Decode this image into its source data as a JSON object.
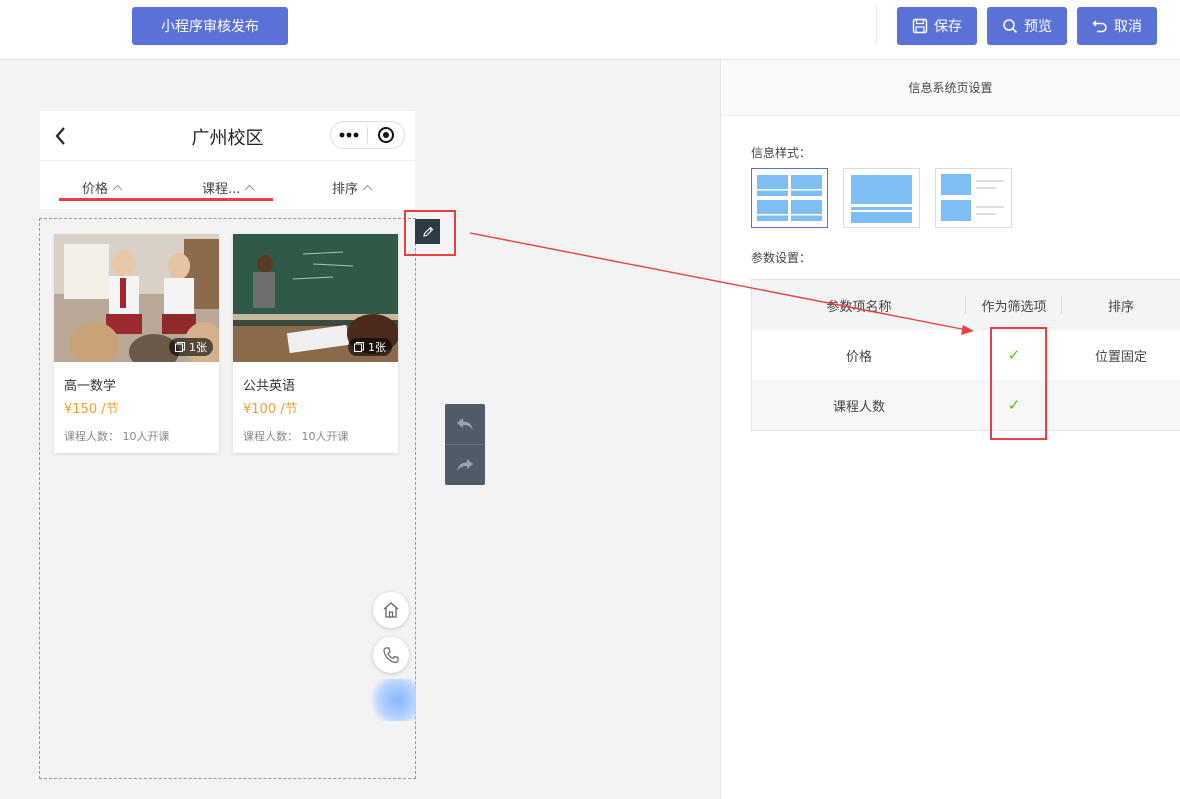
{
  "toolbar": {
    "publish_label": "小程序审核发布",
    "save_label": "保存",
    "preview_label": "预览",
    "cancel_label": "取消"
  },
  "phone": {
    "title": "广州校区",
    "filters": [
      {
        "label": "价格"
      },
      {
        "label": "课程..."
      },
      {
        "label": "排序"
      }
    ],
    "cards": [
      {
        "title": "高一数学",
        "price": "¥150 /节",
        "meta": "课程人数： 10人开课",
        "badge": "1张"
      },
      {
        "title": "公共英语",
        "price": "¥100 /节",
        "meta": "课程人数： 10人开课",
        "badge": "1张"
      }
    ]
  },
  "panel": {
    "title": "信息系统页设置",
    "style_label": "信息样式：",
    "params_label": "参数设置：",
    "table": {
      "headers": [
        "参数项名称",
        "作为筛选项",
        "排序"
      ],
      "rows": [
        {
          "name": "价格",
          "filter": "✓",
          "sort": "位置固定"
        },
        {
          "name": "课程人数",
          "filter": "✓",
          "sort": ""
        }
      ]
    }
  },
  "colors": {
    "accent": "#5a72d8",
    "highlight_red": "#e84040",
    "price_orange": "#f0a030",
    "check_green": "#52c41a"
  }
}
